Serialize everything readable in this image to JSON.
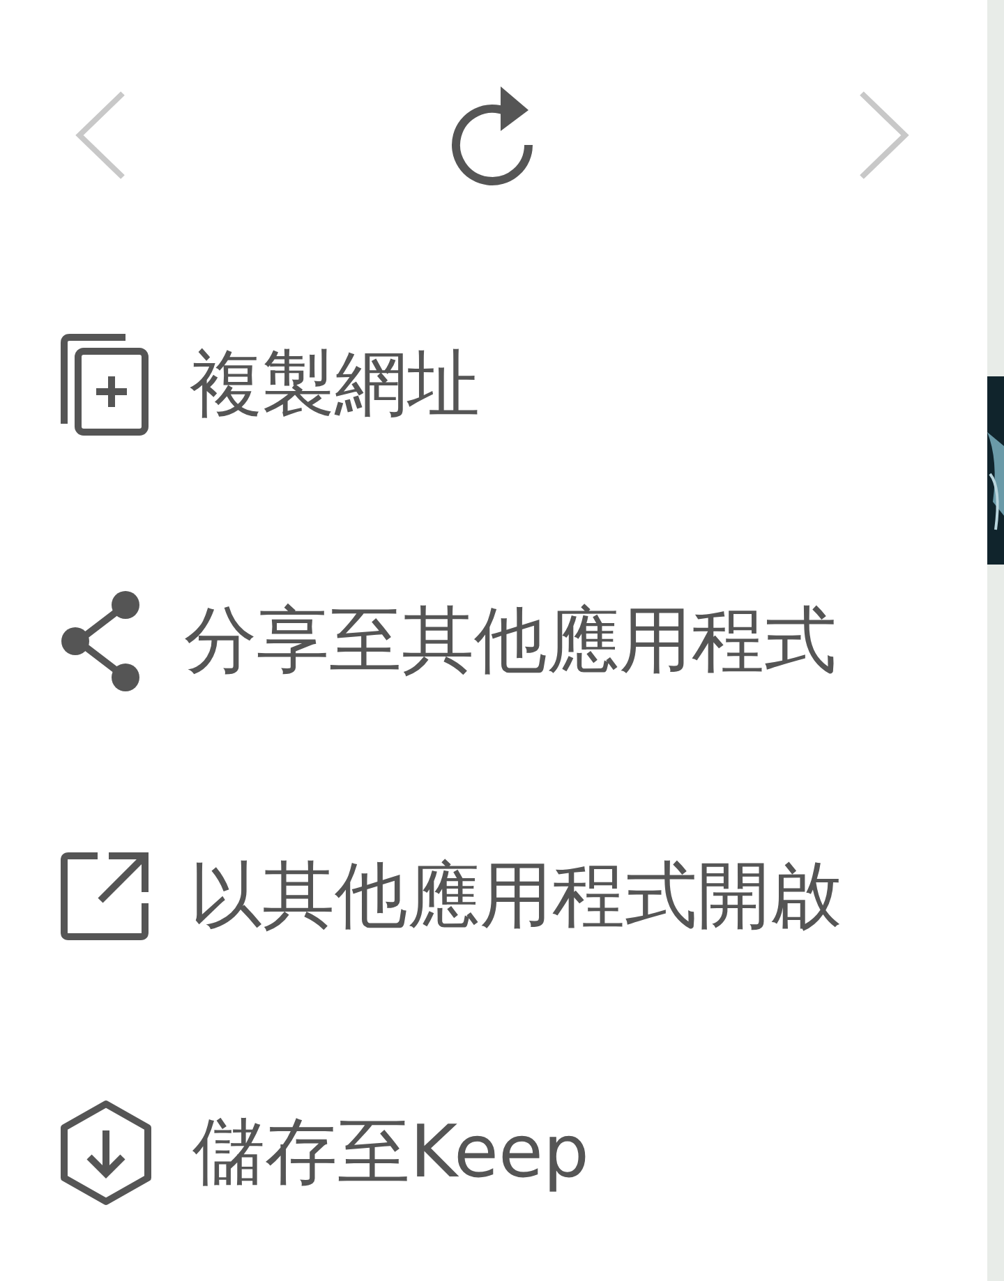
{
  "nav_buttons": [
    {
      "kind": "back",
      "disabled": true
    },
    {
      "kind": "reload",
      "disabled": false
    },
    {
      "kind": "forward",
      "disabled": true
    }
  ],
  "menu_items": [
    {
      "kind": "copy",
      "label": "複製網址"
    },
    {
      "kind": "share",
      "label": "分享至其他應用程式"
    },
    {
      "kind": "open",
      "label": "以其他應用程式開啟"
    },
    {
      "kind": "keep",
      "label": "儲存至Keep"
    }
  ]
}
